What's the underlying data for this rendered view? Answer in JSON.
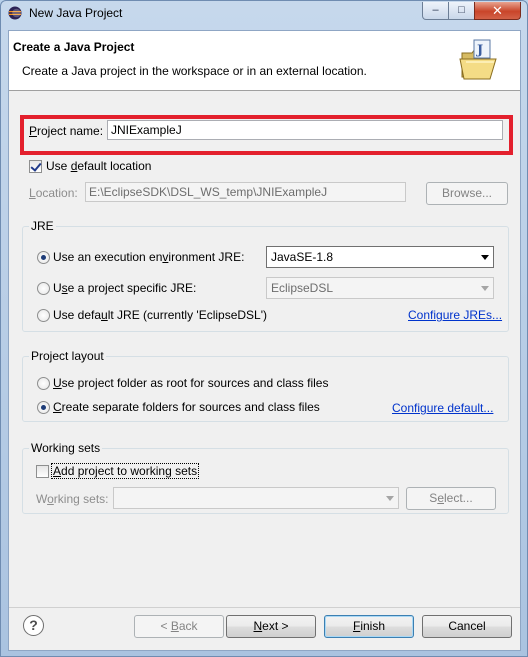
{
  "window": {
    "title": "New Java Project",
    "minimize_glyph": "–",
    "maximize_glyph": "□",
    "close_glyph": "✕"
  },
  "header": {
    "title": "Create a Java Project",
    "description": "Create a Java project in the workspace or in an external location."
  },
  "project_name": {
    "label_prefix": "P",
    "label_rest": "roject name:",
    "value": "JNIExampleJ"
  },
  "default_location": {
    "label_prefix": "Use ",
    "label_mnemonic": "d",
    "label_rest": "efault location",
    "checked": true
  },
  "location": {
    "label_mnemonic": "L",
    "label_rest": "ocation:",
    "value": "E:\\EclipseSDK\\DSL_WS_temp\\JNIExampleJ",
    "browse_label": "Browse..."
  },
  "jre": {
    "title": "JRE",
    "exec_env_label_a": "Use an execution en",
    "exec_env_label_mnemonic": "v",
    "exec_env_label_b": "ironment JRE:",
    "exec_env_value": "JavaSE-1.8",
    "specific_label_a": "U",
    "specific_label_mnemonic": "s",
    "specific_label_b": "e a project specific JRE:",
    "specific_value": "EclipseDSL",
    "default_label_a": "Use defa",
    "default_label_mnemonic": "u",
    "default_label_b": "lt JRE (currently 'EclipseDSL')",
    "configure_link": "Configure JREs...",
    "selected": "exec_env"
  },
  "layout": {
    "title": "Project layout",
    "root_label_a": "",
    "root_label_mnemonic": "U",
    "root_label_b": "se project folder as root for sources and class files",
    "separate_label_a": "",
    "separate_label_mnemonic": "C",
    "separate_label_b": "reate separate folders for sources and class files",
    "configure_link": "Configure default...",
    "selected": "separate"
  },
  "working_sets": {
    "title": "Working sets",
    "add_label_a": "",
    "add_label_mnemonic": "A",
    "add_label_b": "dd project to working sets",
    "sets_label_a": "W",
    "sets_label_mnemonic": "o",
    "sets_label_b": "rking sets:",
    "select_label_a": "S",
    "select_label_mnemonic": "e",
    "select_label_b": "lect..."
  },
  "footer": {
    "help_glyph": "?",
    "back_prefix": "< ",
    "back_mnemonic": "B",
    "back_rest": "ack",
    "next_mnemonic": "N",
    "next_rest": "ext >",
    "finish_mnemonic": "F",
    "finish_rest": "inish",
    "cancel_label": "Cancel"
  },
  "colors": {
    "highlight_box": "#e3202d",
    "link": "#0033cc",
    "title_bar": "#b9d1ea"
  }
}
